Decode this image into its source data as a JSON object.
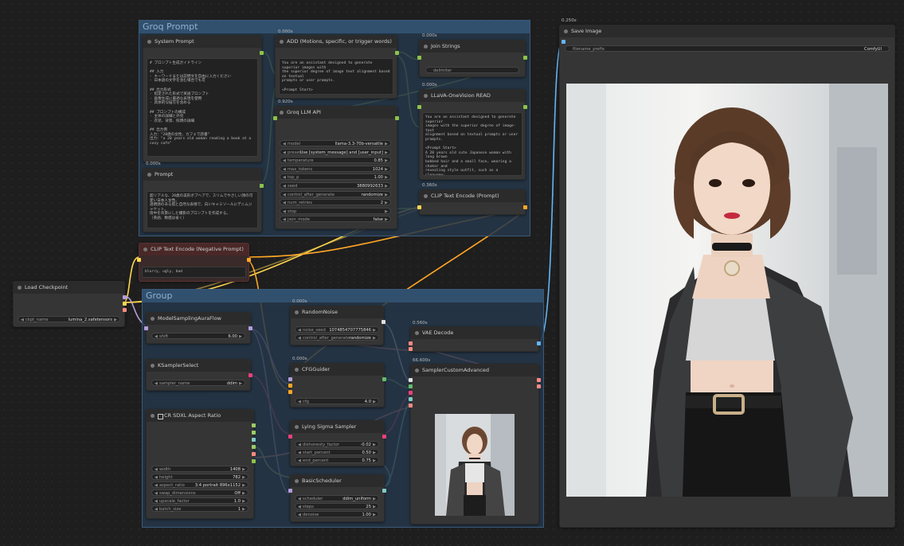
{
  "groups": {
    "groq": {
      "title": "Groq Prompt"
    },
    "bottom": {
      "title": "Group"
    }
  },
  "nodes": {
    "system_prompt": {
      "title": "System Prompt",
      "text": "# プロンプト生成ガイドライン\n\n## 入力\n- キーワードまたは説明文を自由に入力ください\n- 日本語の文字を含む場合でも可\n\n## 出力形式\n- 指定された形式で英語プロンプト\n- 画像生成に最適な表現を使用\n- 具体的な描写を含める\n\n## プロンプトの構成\n- 主体の詳細と外見\n- 衣装、背景、照明の詳細\n\n## 出力例\n入力：\"20歳の女性、カフェで読書\"\n出力：\"a 20 years old woman reading a book at a cozy cafe\""
    },
    "prompt": {
      "title": "Prompt",
      "timing": "0.000s",
      "text": "超リアルな、20歳の美形ボブヘアで、スリムでやさしい顔の可愛い日本人女性。\n透明感のある肌と自然な表情で、白いキャミソールにデニムジャケット。\n街中を背景にした撮影のプロンプトを作成する。\n（英語、数値は省く）"
    },
    "add": {
      "title": "ADD (Motions, specific, or trigger words)",
      "timing": "0.000s",
      "text": "You are an assistant designed to generate superior images with\nthe superior degree of image text alignment based on textual\nprompts or user prompts.\n\n<Prompt Start>"
    },
    "join_strings": {
      "title": "Join Strings",
      "timing": "0.000s",
      "delimiter": "delimiter"
    },
    "llava": {
      "title": "LLaVA-OneVision READ",
      "timing": "0.000s",
      "text": "You are an assistant designed to generate superior\nimages with the superior degree of image-text\nalignment based on textual prompts or user prompts.\n\n<Prompt Start>\nA 20 years old cute Japanese woman with long brown\nbobbed hair and a small face, wearing a choker and\nrevealing style outfit, such as a cleavage-\nexposing off-shoulder top, paired with\nfashionable bottoms, showcasing her petite and\nadorable features\""
    },
    "clip_pos": {
      "title": "CLIP Text Encode (Prompt)",
      "timing": "0.360s"
    },
    "groq_llm": {
      "title": "Groq LLM API",
      "timing": "0.920s",
      "widgets": [
        {
          "label": "model",
          "value": "llama-3.3-70b-versatile"
        },
        {
          "label": "preset",
          "value": "Use [system_message] and [user_input]"
        },
        {
          "label": "temperature",
          "value": "0.85"
        },
        {
          "label": "max_tokens",
          "value": "1024"
        },
        {
          "label": "top_p",
          "value": "1.00"
        },
        {
          "label": "seed",
          "value": "3880992633"
        },
        {
          "label": "control_after_generate",
          "value": "randomize"
        },
        {
          "label": "num_retries",
          "value": "2"
        },
        {
          "label": "stop",
          "value": ""
        },
        {
          "label": "json_mode",
          "value": "false"
        }
      ]
    },
    "clip_neg": {
      "title": "CLIP Text Encode (Negative Prompt)",
      "text": "blurry, ugly, bad"
    },
    "load_checkpoint": {
      "title": "Load Checkpoint",
      "ckpt_label": "ckpt_name",
      "ckpt_value": "lumina_2.safetensors"
    },
    "model_sampling": {
      "title": "ModelSamplingAuraFlow",
      "shift_label": "shift",
      "shift_value": "6.00"
    },
    "ksampler_select": {
      "title": "KSamplerSelect",
      "sampler_label": "sampler_name",
      "sampler_value": "ddim"
    },
    "aspect_ratio": {
      "title": "CR SDXL Aspect Ratio",
      "widgets": [
        {
          "label": "width",
          "value": "1408"
        },
        {
          "label": "height",
          "value": "782"
        },
        {
          "label": "aspect_ratio",
          "value": "3:4 portrait 896x1152"
        },
        {
          "label": "swap_dimensions",
          "value": "Off"
        },
        {
          "label": "upscale_factor",
          "value": "1.0"
        },
        {
          "label": "batch_size",
          "value": "1"
        }
      ]
    },
    "random_noise": {
      "title": "RandomNoise",
      "timing": "0.000s",
      "widgets": [
        {
          "label": "noise_seed",
          "value": "1074854707775846"
        },
        {
          "label": "control_after_generate",
          "value": "randomize"
        }
      ]
    },
    "cfg_guider": {
      "title": "CFGGuider",
      "timing": "0.000s",
      "cfg_label": "cfg",
      "cfg_value": "4.0"
    },
    "lying_sigma": {
      "title": "Lying Sigma Sampler",
      "widgets": [
        {
          "label": "dishonesty_factor",
          "value": "-0.02"
        },
        {
          "label": "start_percent",
          "value": "0.50"
        },
        {
          "label": "end_percent",
          "value": "0.75"
        }
      ]
    },
    "basic_scheduler": {
      "title": "BasicScheduler",
      "widgets": [
        {
          "label": "scheduler",
          "value": "ddim_uniform"
        },
        {
          "label": "steps",
          "value": "25"
        },
        {
          "label": "denoise",
          "value": "1.00"
        }
      ]
    },
    "vae_decode": {
      "title": "VAE Decode",
      "timing": "0.560s"
    },
    "sampler_custom": {
      "title": "SamplerCustomAdvanced",
      "timing": "66.600s"
    },
    "save_image": {
      "title": "Save Image",
      "timing": "0.250s",
      "prefix_label": "filename_prefix",
      "prefix_value": "ComfyUI"
    }
  },
  "colors": {
    "model": "#b39ddb",
    "clip": "#ffd54f",
    "conditioning": "#ffa726",
    "latent": "#ff8a80",
    "image": "#64b5f6",
    "string": "#8bc34a",
    "noise": "#e0e0e0",
    "guider": "#66bb6a",
    "sampler": "#ec407a",
    "sigmas": "#80cbc4",
    "int": "#9ccc65"
  }
}
